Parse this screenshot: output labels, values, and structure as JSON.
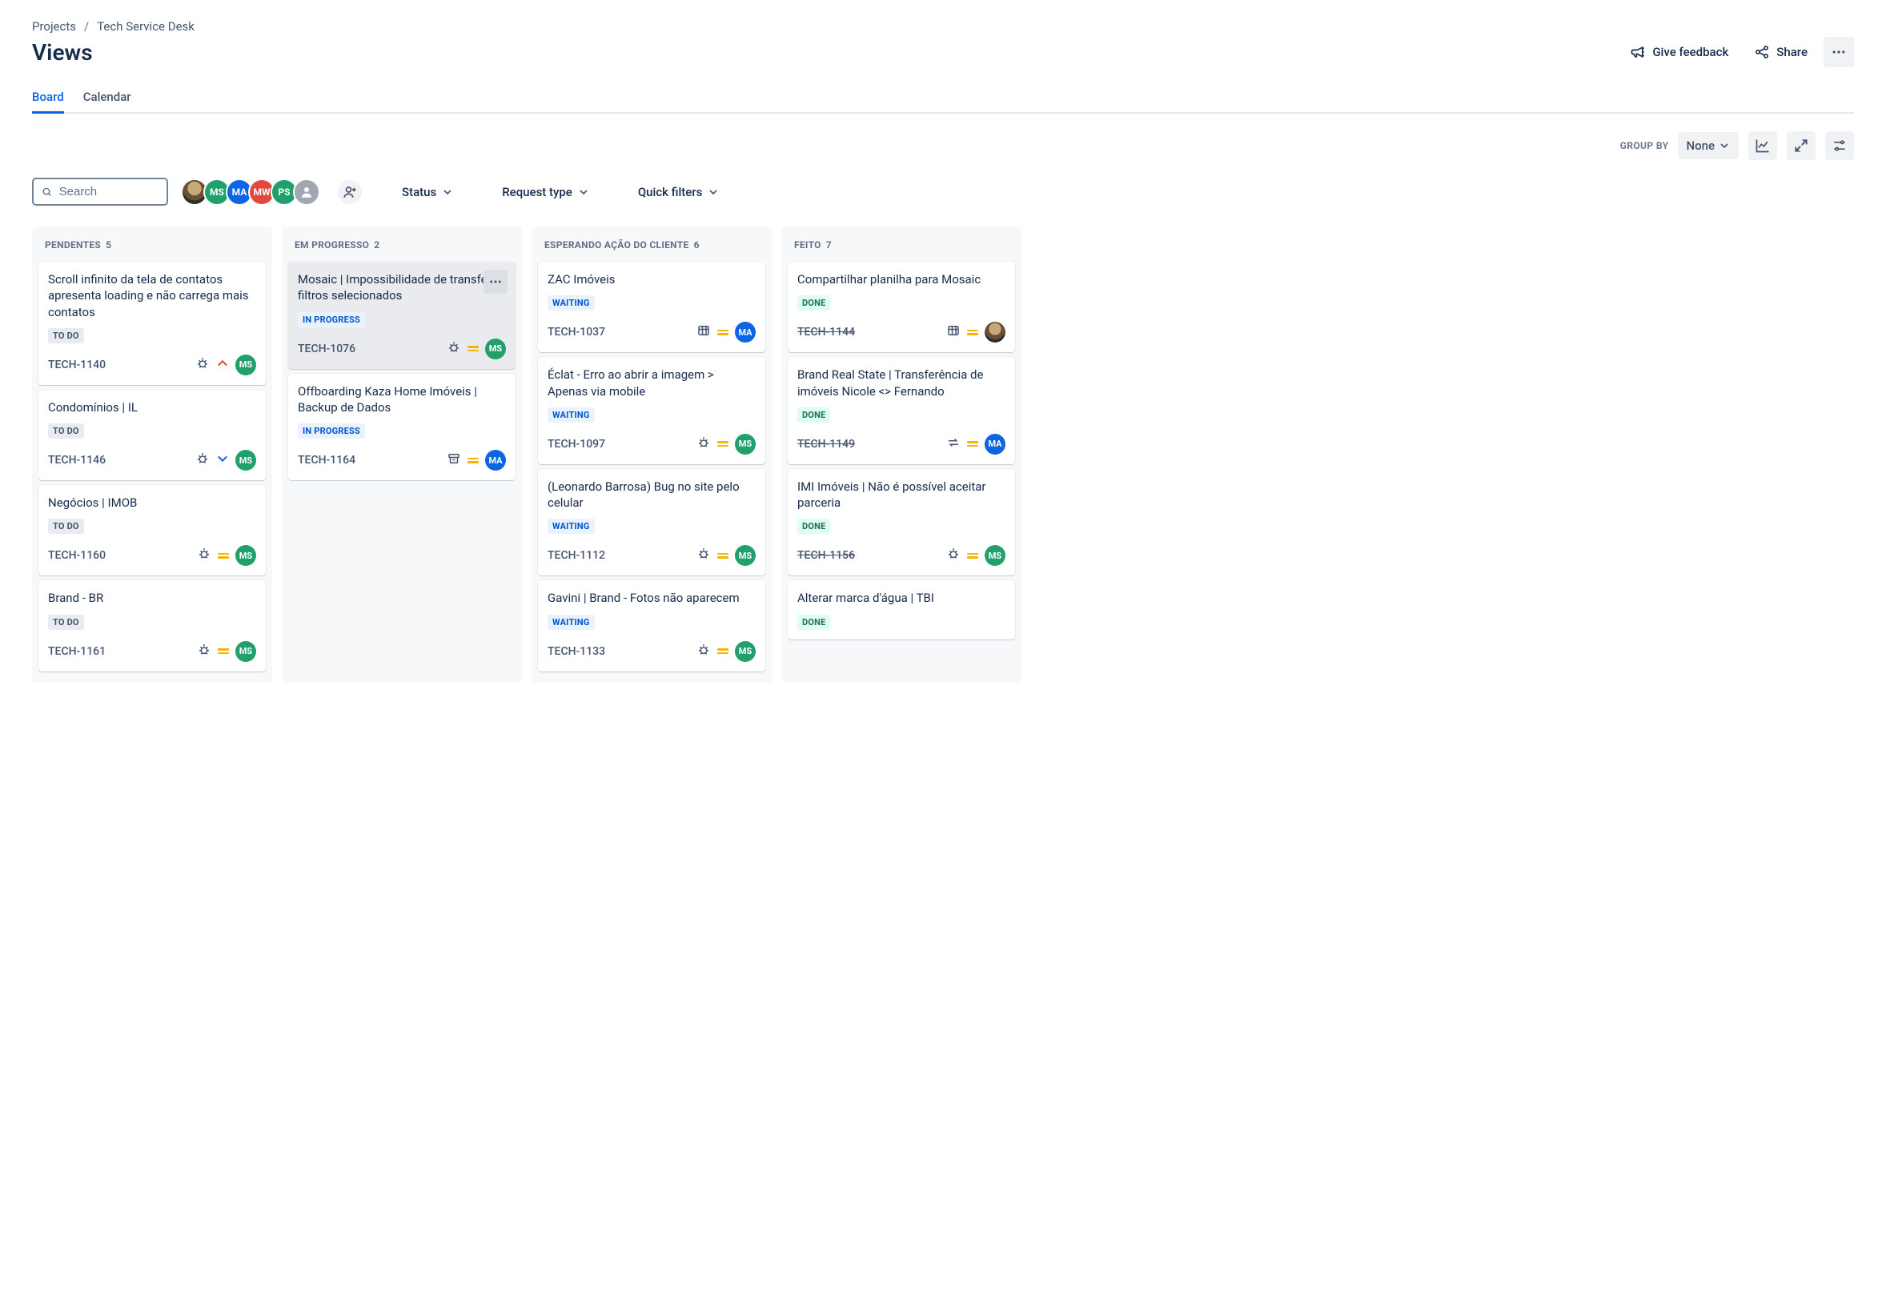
{
  "breadcrumb": {
    "projects": "Projects",
    "project_name": "Tech Service Desk"
  },
  "page": {
    "title": "Views"
  },
  "header": {
    "feedback": "Give feedback",
    "share": "Share"
  },
  "tabs": {
    "board": "Board",
    "calendar": "Calendar"
  },
  "groupby": {
    "label": "GROUP BY",
    "value": "None"
  },
  "search": {
    "placeholder": "Search"
  },
  "avatars": {
    "stack": [
      {
        "initials": "",
        "class": "img"
      },
      {
        "initials": "MS",
        "class": "green"
      },
      {
        "initials": "MA",
        "class": "blue"
      },
      {
        "initials": "MW",
        "class": "orange"
      },
      {
        "initials": "PS",
        "class": "green"
      },
      {
        "initials": "",
        "class": "gray",
        "icon": "person"
      }
    ]
  },
  "filters": {
    "status": "Status",
    "request_type": "Request type",
    "quick": "Quick filters"
  },
  "columns": [
    {
      "name": "PENDENTES",
      "count": "5",
      "cards": [
        {
          "title": "Scroll infinito da tela de contatos apresenta loading e não carrega mais contatos",
          "status": "TO DO",
          "status_class": "loz-todo",
          "key": "TECH-1140",
          "type": "bug",
          "priority": "up",
          "assignee": {
            "initials": "MS",
            "class": "green"
          }
        },
        {
          "title": "Condomínios | IL",
          "status": "TO DO",
          "status_class": "loz-todo",
          "key": "TECH-1146",
          "type": "bug",
          "priority": "down",
          "assignee": {
            "initials": "MS",
            "class": "green"
          }
        },
        {
          "title": "Negócios | IMOB",
          "status": "TO DO",
          "status_class": "loz-todo",
          "key": "TECH-1160",
          "type": "bug",
          "priority": "eq",
          "assignee": {
            "initials": "MS",
            "class": "green"
          }
        },
        {
          "title": "Brand - BR",
          "status": "TO DO",
          "status_class": "loz-todo",
          "key": "TECH-1161",
          "type": "bug",
          "priority": "eq",
          "assignee": {
            "initials": "MS",
            "class": "green"
          }
        }
      ]
    },
    {
      "name": "EM PROGRESSO",
      "count": "2",
      "cards": [
        {
          "title": "Mosaic | Impossibilidade de transferir filtros selecionados",
          "status": "IN PROGRESS",
          "status_class": "loz-prog",
          "key": "TECH-1076",
          "type": "bug",
          "priority": "eq",
          "assignee": {
            "initials": "MS",
            "class": "green"
          },
          "active": true,
          "menu": true
        },
        {
          "title": "Offboarding Kaza Home Imóveis | Backup de Dados",
          "status": "IN PROGRESS",
          "status_class": "loz-prog",
          "key": "TECH-1164",
          "type": "archive",
          "priority": "eq",
          "assignee": {
            "initials": "MA",
            "class": "blue"
          }
        }
      ]
    },
    {
      "name": "ESPERANDO AÇÃO DO CLIENTE",
      "count": "6",
      "cards": [
        {
          "title": "ZAC Imóveis",
          "status": "WAITING",
          "status_class": "loz-wait",
          "key": "TECH-1037",
          "type": "table",
          "priority": "eq",
          "assignee": {
            "initials": "MA",
            "class": "blue"
          }
        },
        {
          "title": "Éclat - Erro ao abrir a imagem > Apenas via mobile",
          "status": "WAITING",
          "status_class": "loz-wait",
          "key": "TECH-1097",
          "type": "bug",
          "priority": "eq",
          "assignee": {
            "initials": "MS",
            "class": "green"
          }
        },
        {
          "title": "(Leonardo Barrosa) Bug no site pelo celular",
          "status": "WAITING",
          "status_class": "loz-wait",
          "key": "TECH-1112",
          "type": "bug",
          "priority": "eq",
          "assignee": {
            "initials": "MS",
            "class": "green"
          }
        },
        {
          "title": "Gavini | Brand - Fotos não aparecem",
          "status": "WAITING",
          "status_class": "loz-wait",
          "key": "TECH-1133",
          "type": "bug",
          "priority": "eq",
          "assignee": {
            "initials": "MS",
            "class": "green"
          }
        }
      ]
    },
    {
      "name": "FEITO",
      "count": "7",
      "cards": [
        {
          "title": "Compartilhar planilha para Mosaic",
          "status": "DONE",
          "status_class": "loz-done",
          "key": "TECH-1144",
          "key_done": true,
          "type": "table",
          "priority": "eq",
          "assignee": {
            "initials": "",
            "class": "img"
          }
        },
        {
          "title": "Brand Real State | Transferência de imóveis Nicole <> Fernando",
          "status": "DONE",
          "status_class": "loz-done",
          "key": "TECH-1149",
          "key_done": true,
          "type": "transfer",
          "priority": "eq",
          "assignee": {
            "initials": "MA",
            "class": "blue"
          }
        },
        {
          "title": "IMI Imóveis | Não é possível aceitar parceria",
          "status": "DONE",
          "status_class": "loz-done",
          "key": "TECH-1156",
          "key_done": true,
          "type": "bug",
          "priority": "eq",
          "assignee": {
            "initials": "MS",
            "class": "green"
          }
        },
        {
          "title": "Alterar marca d'água | TBI",
          "status": "DONE",
          "status_class": "loz-done",
          "key": "",
          "type": "",
          "priority": "",
          "assignee": null
        }
      ]
    }
  ]
}
